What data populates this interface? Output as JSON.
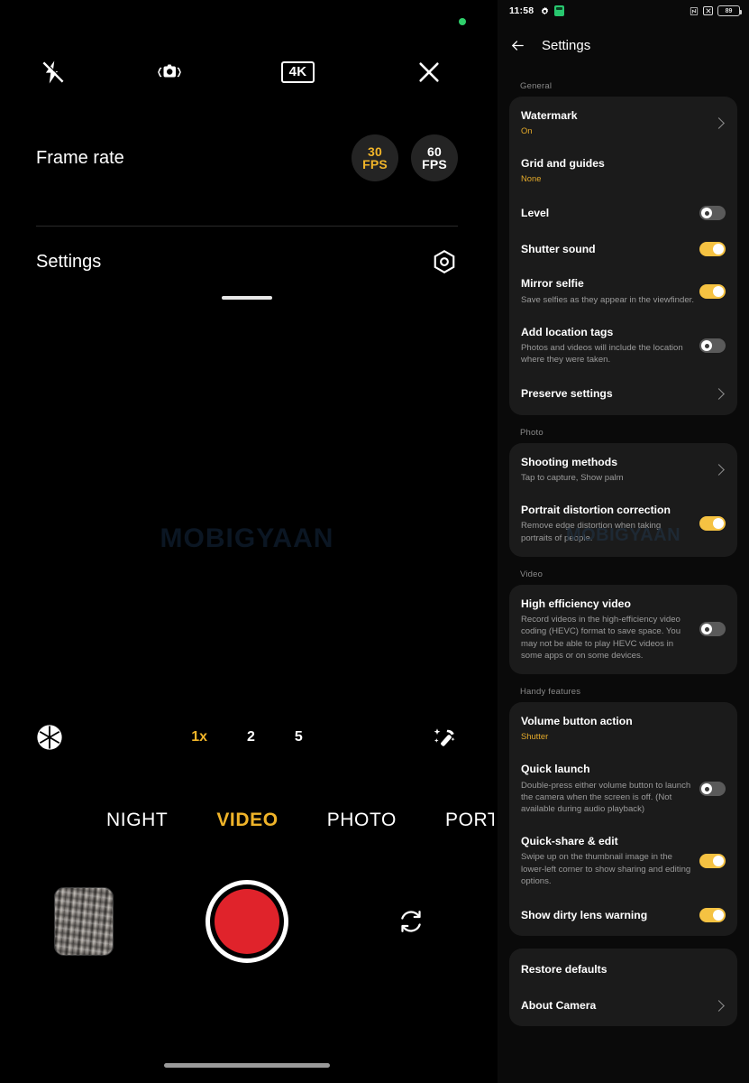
{
  "camera": {
    "recording_indicator": "recording-dot",
    "topbar": [
      {
        "name": "flash-off-icon",
        "label": "Flash off"
      },
      {
        "name": "stabilization-icon",
        "label": "Stabilization"
      },
      {
        "name": "resolution-badge",
        "label": "4K"
      },
      {
        "name": "close-icon",
        "label": "Close"
      }
    ],
    "resolution": "4K",
    "frame_rate": {
      "label": "Frame rate",
      "options": [
        {
          "value": "30",
          "unit": "FPS",
          "selected": true
        },
        {
          "value": "60",
          "unit": "FPS",
          "selected": false
        }
      ]
    },
    "settings_row": {
      "label": "Settings",
      "icon": "aperture-settings-icon"
    },
    "watermark": "MOBIGYAAN",
    "zoom": {
      "options": [
        {
          "label": "1x",
          "selected": true
        },
        {
          "label": "2",
          "selected": false
        },
        {
          "label": "5",
          "selected": false
        }
      ],
      "left_icon": "aperture-icon",
      "right_icon": "magic-wand-icon"
    },
    "modes": [
      {
        "label": "NIGHT",
        "selected": false
      },
      {
        "label": "VIDEO",
        "selected": true
      },
      {
        "label": "PHOTO",
        "selected": false
      },
      {
        "label": "PORTRAIT",
        "selected": false
      }
    ],
    "bottom": {
      "thumbnail": "gallery-thumbnail",
      "shutter": "record-button",
      "flip": "switch-camera-icon"
    },
    "accent_color": "#f0b429",
    "record_color": "#e0232b"
  },
  "settings": {
    "statusbar": {
      "time": "11:58",
      "left_icons": [
        "gear-icon",
        "app-badge-icon"
      ],
      "right_icons": [
        "nfc-icon",
        "alarm-off-icon",
        "battery-icon"
      ],
      "battery_level": "89"
    },
    "appbar": {
      "back": "back-arrow-icon",
      "title": "Settings"
    },
    "watermark": "MOBIGYAAN",
    "sections": [
      {
        "label": "General",
        "rows": [
          {
            "title": "Watermark",
            "sub": "On",
            "sub_style": "amber",
            "control": "chevron"
          },
          {
            "title": "Grid and guides",
            "sub": "None",
            "sub_style": "amber",
            "control": "none"
          },
          {
            "title": "Level",
            "sub": "",
            "control": "toggle",
            "toggle": "off"
          },
          {
            "title": "Shutter sound",
            "sub": "",
            "control": "toggle",
            "toggle": "on"
          },
          {
            "title": "Mirror selfie",
            "sub": "Save selfies as they appear in the viewfinder.",
            "control": "toggle",
            "toggle": "on"
          },
          {
            "title": "Add location tags",
            "sub": "Photos and videos will include the location where they were taken.",
            "control": "toggle",
            "toggle": "off"
          },
          {
            "title": "Preserve settings",
            "sub": "",
            "control": "chevron"
          }
        ]
      },
      {
        "label": "Photo",
        "rows": [
          {
            "title": "Shooting methods",
            "sub": "Tap to capture, Show palm",
            "control": "chevron"
          },
          {
            "title": "Portrait distortion correction",
            "sub": "Remove edge distortion when taking portraits of people.",
            "control": "toggle",
            "toggle": "on"
          }
        ]
      },
      {
        "label": "Video",
        "rows": [
          {
            "title": "High efficiency video",
            "sub": "Record videos in the high-efficiency video coding (HEVC) format to save space. You may not be able to play HEVC videos in some apps or on some devices.",
            "control": "toggle",
            "toggle": "off"
          }
        ]
      },
      {
        "label": "Handy features",
        "rows": [
          {
            "title": "Volume button action",
            "sub": "Shutter",
            "sub_style": "amber",
            "control": "none"
          },
          {
            "title": "Quick launch",
            "sub": "Double-press either volume button to launch the camera when the screen is off. (Not available during audio playback)",
            "control": "toggle",
            "toggle": "off"
          },
          {
            "title": "Quick-share & edit",
            "sub": "Swipe up on the thumbnail image in the lower-left corner to show sharing and editing options.",
            "control": "toggle",
            "toggle": "on"
          },
          {
            "title": "Show dirty lens warning",
            "sub": "",
            "control": "toggle",
            "toggle": "on"
          }
        ]
      },
      {
        "label": "",
        "rows": [
          {
            "title": "Restore defaults",
            "sub": "",
            "control": "none"
          },
          {
            "title": "About Camera",
            "sub": "",
            "control": "chevron"
          }
        ]
      }
    ],
    "accent_color": "#f5c242",
    "card_color": "#1b1b1b"
  }
}
